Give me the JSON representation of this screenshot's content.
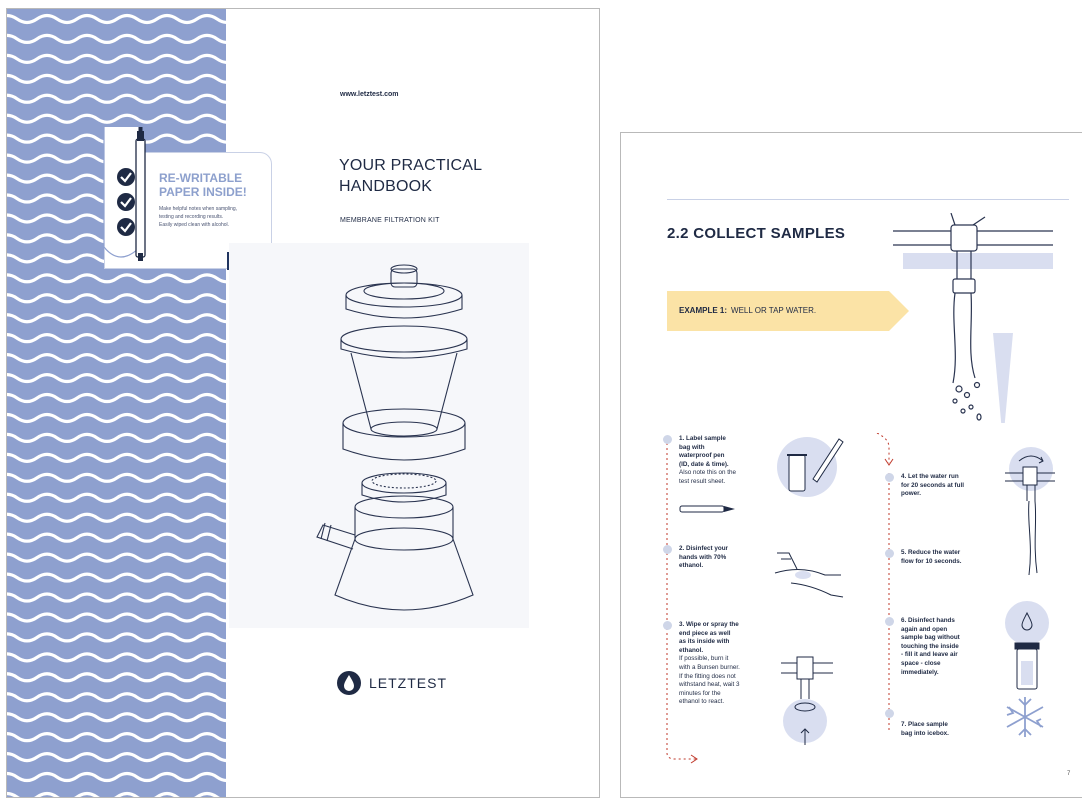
{
  "cover": {
    "url": "www.letztest.com",
    "title_line1": "YOUR PRACTICAL",
    "title_line2": "HANDBOOK",
    "subtitle": "MEMBRANE FILTRATION KIT",
    "brand": "LETZTEST",
    "tag": {
      "heading_line1": "RE-WRITABLE",
      "heading_line2": "PAPER INSIDE!",
      "body_line1": "Make helpful notes when sampling,",
      "body_line2": "testing and recording results.",
      "body_line3": "Easily wiped clean with alcohol."
    }
  },
  "inner": {
    "heading": "2.2 COLLECT SAMPLES",
    "banner_bold": "EXAMPLE 1:",
    "banner_text": "WELL OR TAP WATER.",
    "page_number": "7",
    "steps": [
      {
        "lines_bold": [
          "1. Label sample",
          "bag with",
          "waterproof pen",
          "(ID, date & time)."
        ],
        "lines": [
          "Also note this on the",
          "test result sheet."
        ]
      },
      {
        "lines_bold": [
          "2. Disinfect your",
          "hands with 70%",
          "ethanol."
        ],
        "lines": []
      },
      {
        "lines_bold": [
          "3. Wipe or spray the",
          "end piece as well",
          "as its inside with",
          "ethanol."
        ],
        "lines": [
          "If possible, burn it",
          "with a Bunsen burner.",
          "If the fitting does not",
          "withstand heat, wait 3",
          "minutes for the",
          "ethanol to react."
        ]
      },
      {
        "lines_bold": [
          "4. Let the water run",
          "for 20 seconds at full",
          "power."
        ],
        "lines": []
      },
      {
        "lines_bold": [
          "5. Reduce the water",
          "flow for 10 seconds."
        ],
        "lines": []
      },
      {
        "lines_bold": [
          "6. Disinfect hands",
          "again and open",
          "sample bag without",
          "touching the inside",
          "- fill it and leave air",
          "space - close",
          "immediately."
        ],
        "lines": []
      },
      {
        "lines_bold": [
          "7. Place sample",
          "bag into icebox."
        ],
        "lines": []
      }
    ]
  },
  "colors": {
    "navy": "#1f2a44",
    "wave_blue": "#8ea0cf",
    "banner_yellow": "#fbe3a6",
    "accent_red": "#c0392b"
  },
  "icons": [
    "check-icon",
    "pen-icon",
    "water-drop-logo-icon",
    "pipe-tap-icon",
    "snowflake-icon",
    "hands-icon",
    "sample-bag-icon"
  ]
}
